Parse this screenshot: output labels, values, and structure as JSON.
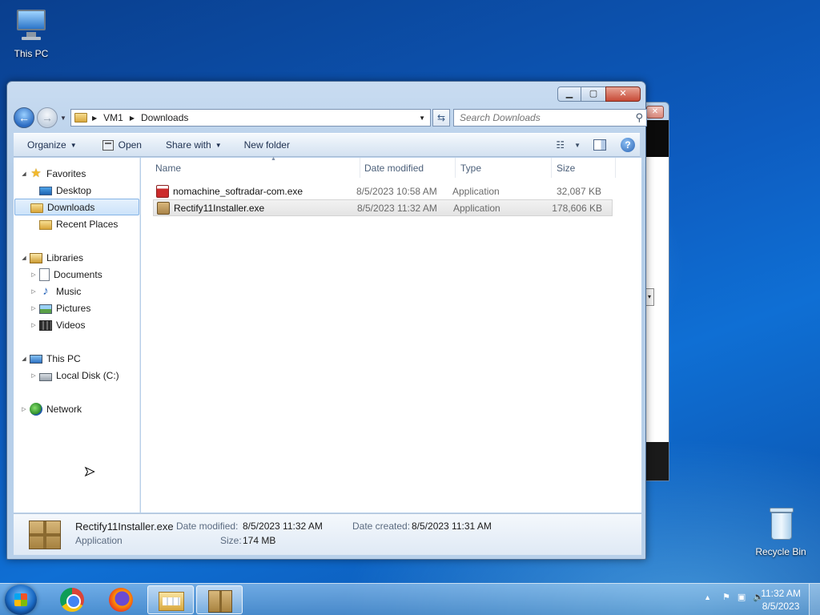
{
  "desktop": {
    "icons": [
      {
        "label": "This PC",
        "icon": "monitor-icon"
      },
      {
        "label": "Recycle Bin",
        "icon": "recycle-bin-icon"
      }
    ]
  },
  "window": {
    "nav": {
      "back": "←",
      "forward": "→"
    },
    "address": {
      "crumbs": [
        "VM1",
        "Downloads"
      ]
    },
    "search": {
      "placeholder": "Search Downloads"
    },
    "commands": {
      "organize": "Organize",
      "open": "Open",
      "share_with": "Share with",
      "new_folder": "New folder"
    },
    "nav_pane": {
      "favorites": "Favorites",
      "desktop": "Desktop",
      "downloads": "Downloads",
      "recent_places": "Recent Places",
      "libraries": "Libraries",
      "documents": "Documents",
      "music": "Music",
      "pictures": "Pictures",
      "videos": "Videos",
      "this_pc": "This PC",
      "local_disk": "Local Disk (C:)",
      "network": "Network"
    },
    "columns": {
      "name": "Name",
      "date": "Date modified",
      "type": "Type",
      "size": "Size"
    },
    "files": [
      {
        "name": "nomachine_softradar-com.exe",
        "date": "8/5/2023 10:58 AM",
        "type": "Application",
        "size": "32,087 KB"
      },
      {
        "name": "Rectify11Installer.exe",
        "date": "8/5/2023 11:32 AM",
        "type": "Application",
        "size": "178,606 KB"
      }
    ],
    "details": {
      "name": "Rectify11Installer.exe",
      "kind": "Application",
      "date_modified_label": "Date modified:",
      "date_modified": "8/5/2023 11:32 AM",
      "size_label": "Size:",
      "size": "174 MB",
      "date_created_label": "Date created:",
      "date_created": "8/5/2023 11:31 AM"
    }
  },
  "taskbar": {
    "time": "11:32 AM",
    "date": "8/5/2023",
    "tray_arrow": "▲"
  }
}
